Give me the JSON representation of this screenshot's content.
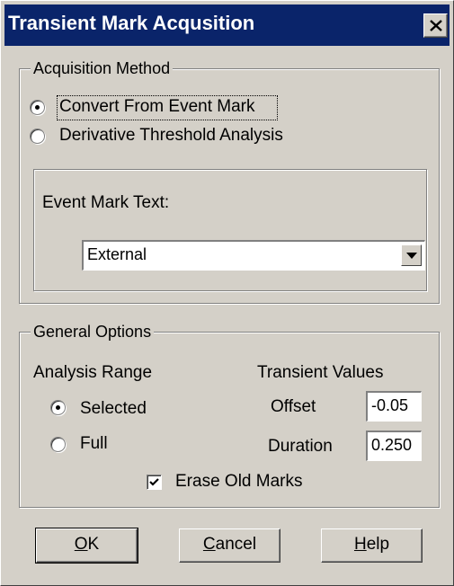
{
  "window": {
    "title": "Transient Mark Acqusition",
    "close_icon": "close-icon"
  },
  "acquisition_method": {
    "legend": "Acquisition Method",
    "options": [
      {
        "label": "Convert From Event Mark",
        "selected": true
      },
      {
        "label": "Derivative Threshold Analysis",
        "selected": false
      }
    ],
    "event_mark_text_label": "Event Mark Text:",
    "event_mark_text_value": "External"
  },
  "general_options": {
    "legend": "General Options",
    "analysis_range_label": "Analysis Range",
    "range_options": [
      {
        "label": "Selected",
        "selected": true
      },
      {
        "label": "Full",
        "selected": false
      }
    ],
    "transient_values_label": "Transient Values",
    "offset_label": "Offset",
    "offset_value": "-0.05",
    "duration_label": "Duration",
    "duration_value": "0.250",
    "erase_label": "Erase Old Marks",
    "erase_checked": true
  },
  "buttons": {
    "ok_mnemonic": "O",
    "ok_rest": "K",
    "cancel_mnemonic": "C",
    "cancel_rest": "ancel",
    "help_mnemonic": "H",
    "help_rest": "elp"
  }
}
